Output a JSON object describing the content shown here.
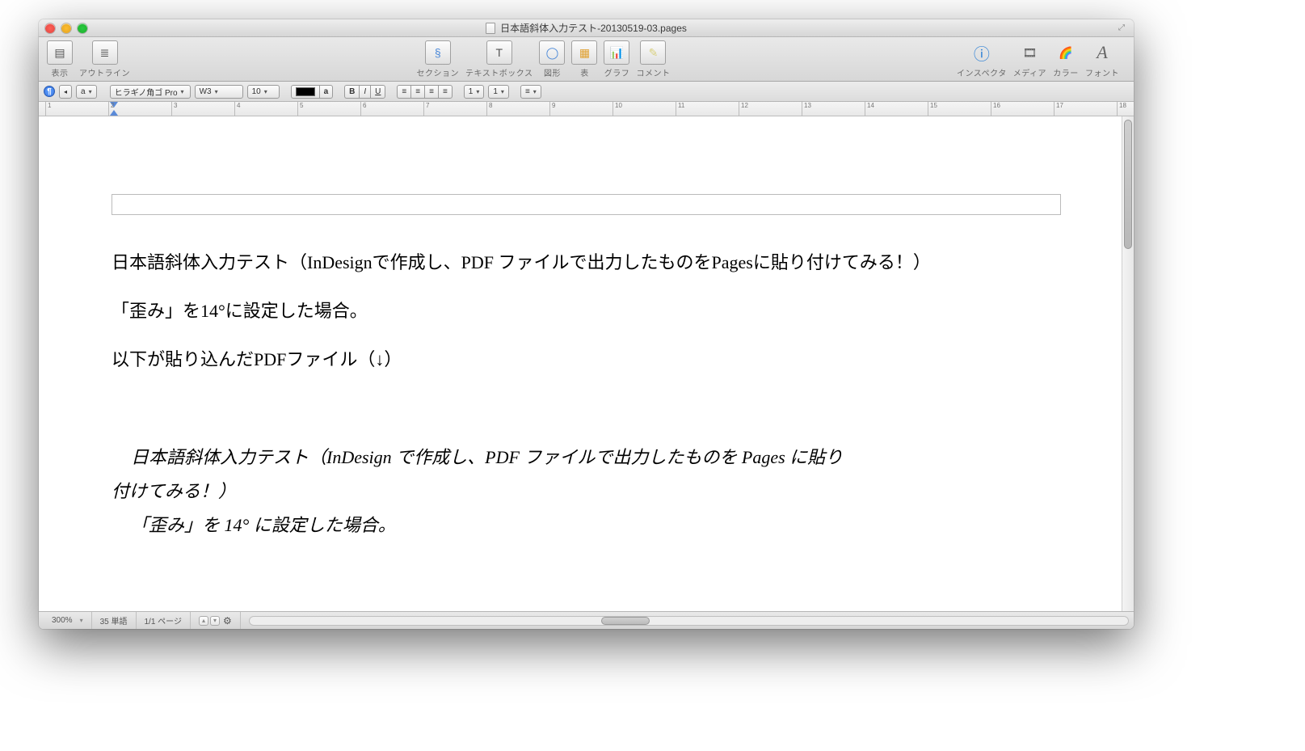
{
  "window": {
    "title": "日本語斜体入力テスト-20130519-03.pages"
  },
  "toolbar": {
    "left": [
      {
        "icon": "view",
        "label": "表示"
      },
      {
        "icon": "outline",
        "label": "アウトライン"
      }
    ],
    "center": [
      {
        "icon": "section",
        "label": "セクション"
      },
      {
        "icon": "textbox",
        "label": "テキストボックス"
      },
      {
        "icon": "shape",
        "label": "図形"
      },
      {
        "icon": "table",
        "label": "表"
      },
      {
        "icon": "chart",
        "label": "グラフ"
      },
      {
        "icon": "comment",
        "label": "コメント"
      }
    ],
    "right": [
      {
        "icon": "inspector",
        "label": "インスペクタ"
      },
      {
        "icon": "media",
        "label": "メディア"
      },
      {
        "icon": "colors",
        "label": "カラー"
      },
      {
        "icon": "fonts",
        "label": "フォント"
      }
    ]
  },
  "formatBar": {
    "pilcrow": "¶",
    "styleMenu": "a",
    "fontFamily": "ヒラギノ角ゴ Pro",
    "fontWeight": "W3",
    "fontSize": "10",
    "charA": "a",
    "bold": "B",
    "italic": "I",
    "underline": "U",
    "alignLeft": "≡",
    "alignCenter": "≡",
    "alignRight": "≡",
    "alignJustify": "≡",
    "spacing": "1",
    "columns": "1",
    "list": "≡"
  },
  "ruler": {
    "marks": [
      "1",
      "2",
      "3",
      "4",
      "5",
      "6",
      "7",
      "8",
      "9",
      "10",
      "11",
      "12",
      "13",
      "14",
      "15",
      "16",
      "17",
      "18"
    ]
  },
  "document": {
    "para1": "日本語斜体入力テスト（InDesignで作成し、PDF ファイルで出力したものをPagesに貼り付けてみる！）",
    "para2": "「歪み」を14°に設定した場合。",
    "para3": "以下が貼り込んだPDFファイル（↓）",
    "italic1a": "日本語斜体入力テスト（InDesign で作成し、PDF ファイルで出力したものを Pages に貼り",
    "italic1b": "付けてみる！）",
    "italic2": "「歪み」を 14° に設定した場合。"
  },
  "statusBar": {
    "zoom": "300%",
    "words": "35 単語",
    "pages": "1/1 ページ"
  }
}
